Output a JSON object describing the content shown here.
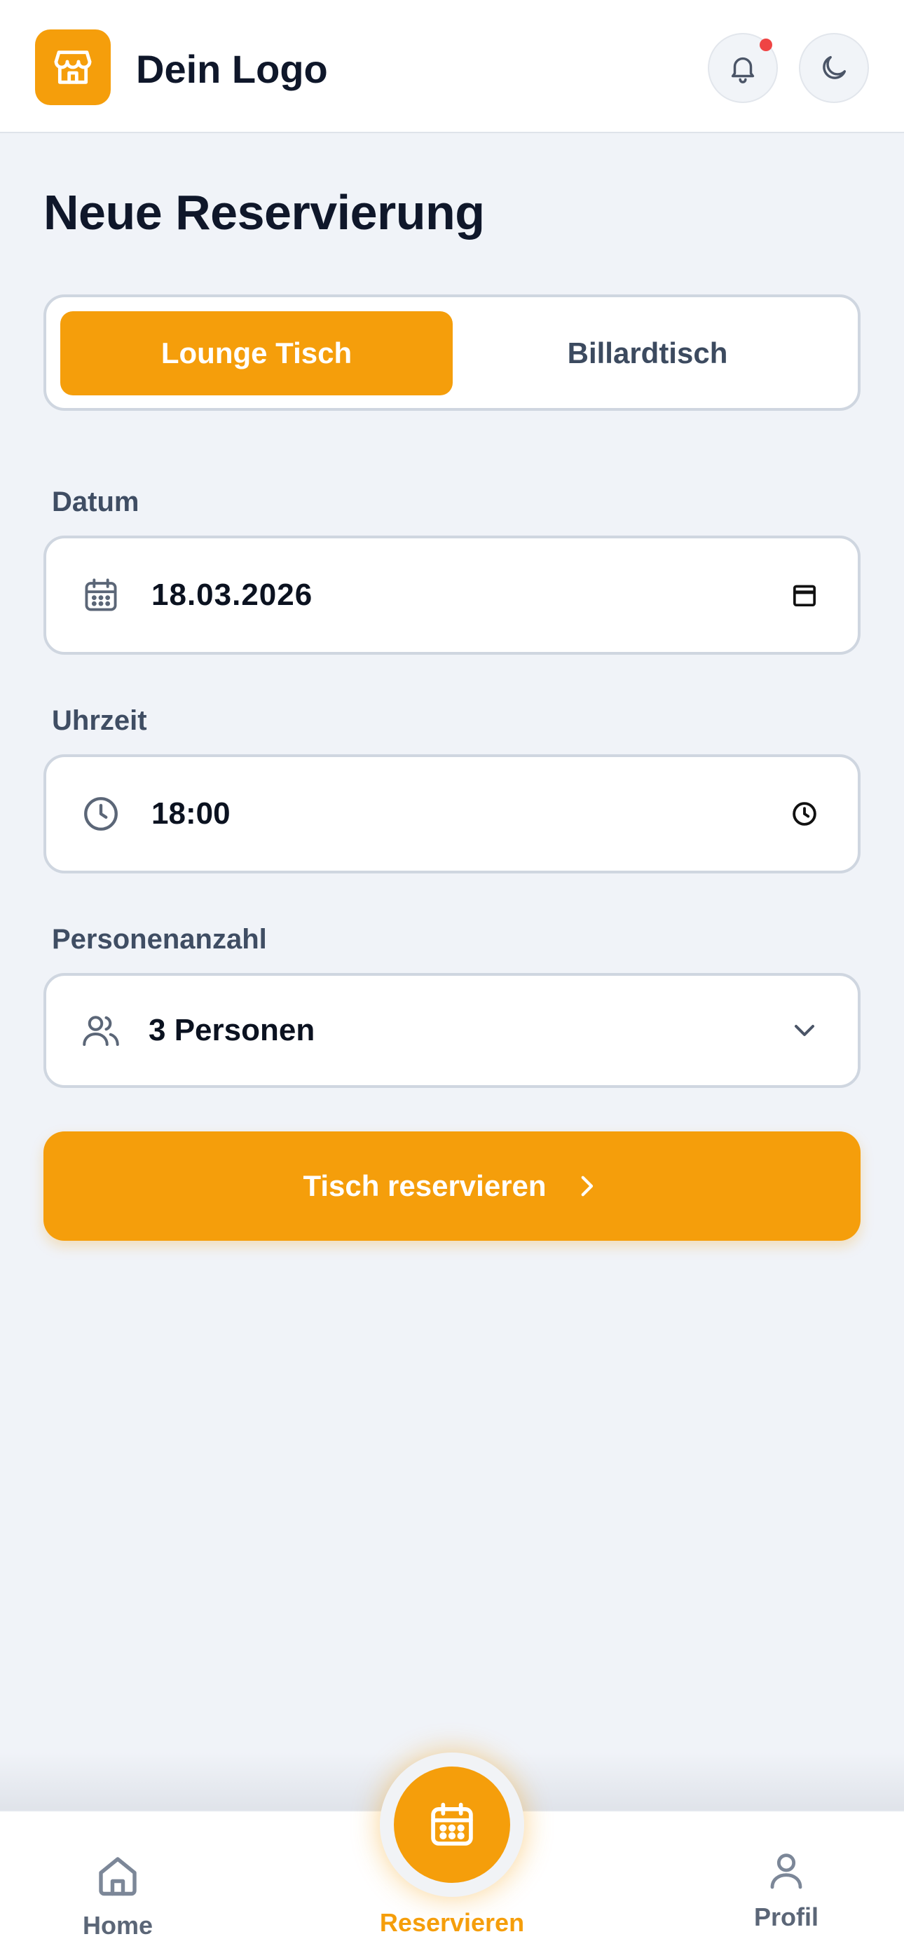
{
  "header": {
    "logo_text": "Dein Logo",
    "accent_color": "#f59e0b",
    "notification_dot_color": "#ef4444"
  },
  "page": {
    "title": "Neue Reservierung"
  },
  "table_type": {
    "options": [
      {
        "label": "Lounge Tisch",
        "active": true
      },
      {
        "label": "Billardtisch",
        "active": false
      }
    ]
  },
  "form": {
    "date": {
      "label": "Datum",
      "value": "18.03.2026",
      "icon": "calendar-icon"
    },
    "time": {
      "label": "Uhrzeit",
      "value": "18:00",
      "icon": "clock-icon"
    },
    "guests": {
      "label": "Personenanzahl",
      "value": "3 Personen",
      "icon": "users-icon"
    },
    "submit_label": "Tisch reservieren"
  },
  "bottom_nav": {
    "items": [
      {
        "label": "Home",
        "icon": "home-icon",
        "active": false
      },
      {
        "label": "Reservieren",
        "icon": "calendar-icon",
        "active": true
      },
      {
        "label": "Profil",
        "icon": "user-icon",
        "active": false
      }
    ]
  }
}
